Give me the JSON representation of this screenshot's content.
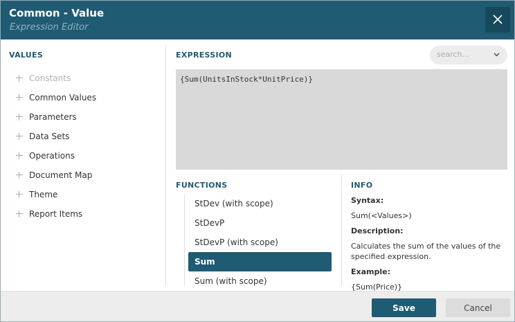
{
  "header": {
    "title": "Common - Value",
    "subtitle": "Expression Editor",
    "close_icon": "close-icon"
  },
  "values": {
    "title": "VALUES",
    "items": [
      {
        "label": "Constants",
        "disabled": true
      },
      {
        "label": "Common Values",
        "disabled": false
      },
      {
        "label": "Parameters",
        "disabled": false
      },
      {
        "label": "Data Sets",
        "disabled": false
      },
      {
        "label": "Operations",
        "disabled": false
      },
      {
        "label": "Document Map",
        "disabled": false
      },
      {
        "label": "Theme",
        "disabled": false
      },
      {
        "label": "Report Items",
        "disabled": false
      }
    ]
  },
  "expression": {
    "title": "EXPRESSION",
    "value": "{Sum(UnitsInStock*UnitPrice)}",
    "search_placeholder": "search..."
  },
  "functions": {
    "title": "FUNCTIONS",
    "items": [
      {
        "label": "StDev (with scope)",
        "selected": false
      },
      {
        "label": "StDevP",
        "selected": false
      },
      {
        "label": "StDevP (with scope)",
        "selected": false
      },
      {
        "label": "Sum",
        "selected": true
      },
      {
        "label": "Sum (with scope)",
        "selected": false
      }
    ]
  },
  "info": {
    "title": "INFO",
    "syntax_label": "Syntax:",
    "syntax": "Sum(<Values>)",
    "description_label": "Description:",
    "description": "Calculates the sum of the values of the specified expression.",
    "example_label": "Example:",
    "example": "{Sum(Price)}"
  },
  "footer": {
    "save_label": "Save",
    "cancel_label": "Cancel"
  },
  "colors": {
    "header_bg": "#1f5b73",
    "accent": "#1f5b73",
    "expression_bg": "#d9d9d9"
  }
}
